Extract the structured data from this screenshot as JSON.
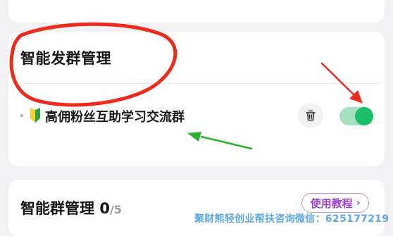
{
  "group_section": {
    "title": "智能发群管理",
    "group_name": "高佣粉丝互助学习交流群",
    "toggle_on": true
  },
  "manage_section": {
    "title": "智能群管理",
    "count": "0",
    "total": "/5",
    "tutorial_label": "使用教程",
    "tutorial_chevron": "›"
  },
  "watermark": {
    "text": "聚财熊轻创业帮扶咨询微信：625177219"
  },
  "colors": {
    "toggle_on": "#1cc06a",
    "toggle_track": "#a6e2c2",
    "tutorial_accent": "#9b3fd0",
    "annotation_red": "#ee2a1c",
    "annotation_green": "#2bb12e",
    "watermark": "#5da9e3"
  },
  "icons": [
    "beginner-mark-icon",
    "trash-icon"
  ],
  "annotations": [
    "red-ellipse-highlight",
    "red-arrow",
    "green-arrow"
  ]
}
